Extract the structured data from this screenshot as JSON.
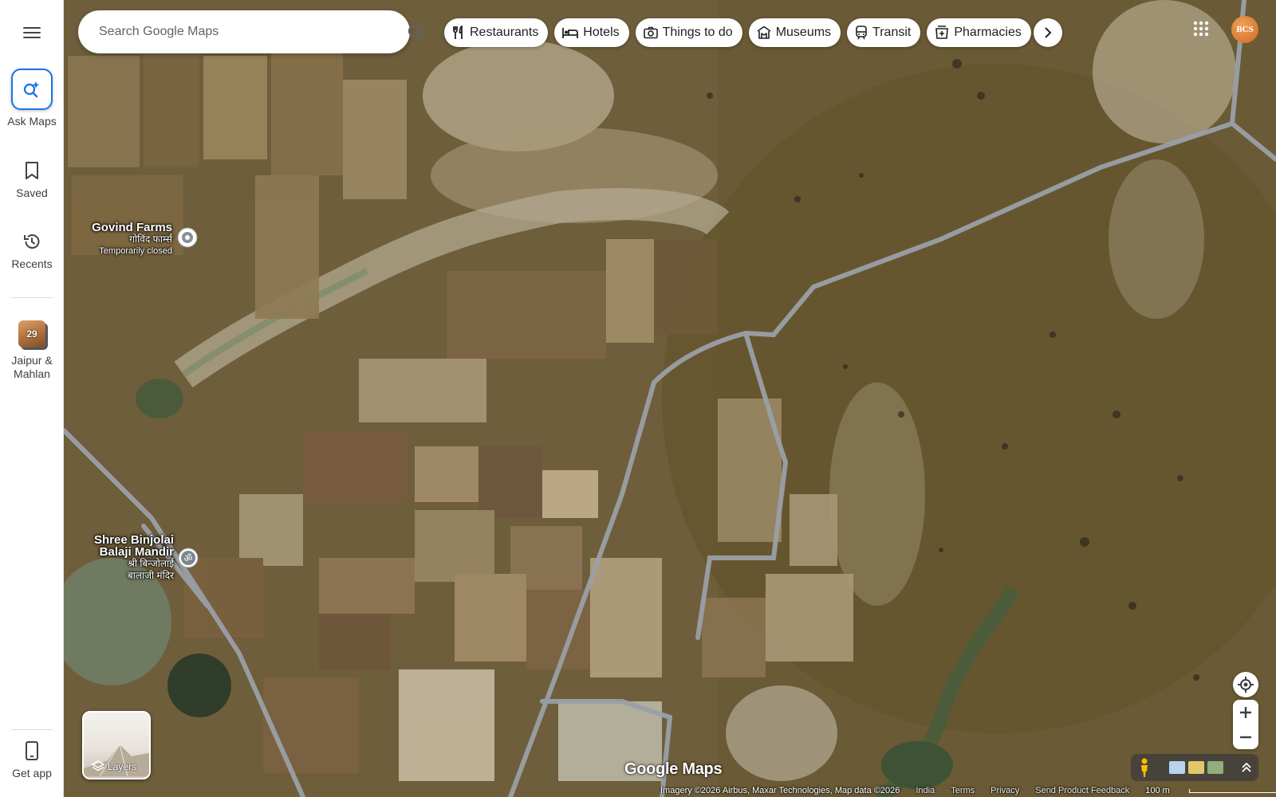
{
  "search": {
    "placeholder": "Search Google Maps"
  },
  "chips": [
    {
      "label": "Restaurants",
      "icon": "fork-knife-icon"
    },
    {
      "label": "Hotels",
      "icon": "bed-icon"
    },
    {
      "label": "Things to do",
      "icon": "camera-icon"
    },
    {
      "label": "Museums",
      "icon": "museum-icon"
    },
    {
      "label": "Transit",
      "icon": "train-icon"
    },
    {
      "label": "Pharmacies",
      "icon": "pharmacy-icon"
    }
  ],
  "rail": {
    "ask": "Ask Maps",
    "saved": "Saved",
    "recents": "Recents",
    "recent_place_line1": "Jaipur &",
    "recent_place_line2": "Mahlan",
    "recent_badge": "29",
    "get_app": "Get app"
  },
  "account": {
    "avatar_text": "BCS"
  },
  "places": [
    {
      "name": "Govind Farms",
      "name_hi": "गोविंद फार्म्स",
      "status": "Temporarily closed"
    },
    {
      "name_line1": "Shree Binjolai",
      "name_line2": "Balaji Mandir",
      "name_hi_line1": "श्री बिन्जोलाई",
      "name_hi_line2": "बालाजी मंदिर"
    }
  ],
  "layers_label": "Layers",
  "logo": "Google Maps",
  "footer": {
    "attribution": "Imagery ©2026 Airbus, Maxar Technologies, Map data ©2026",
    "links": [
      "India",
      "Terms",
      "Privacy",
      "Send Product Feedback"
    ],
    "scale": "100 m"
  },
  "colors": {
    "accent": "#1a73e8",
    "road": "#9aa0a6",
    "terrain": "#6b5a3a"
  }
}
